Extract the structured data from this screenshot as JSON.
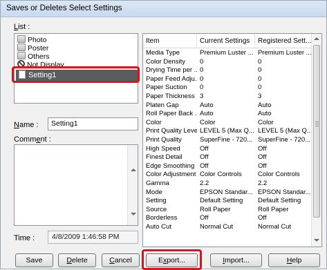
{
  "window": {
    "title": "Saves or Deletes Select Settings"
  },
  "list": {
    "label_prefix": "",
    "label_underline": "L",
    "label_rest": "ist :",
    "items": [
      {
        "label": "Photo",
        "icon": "folder-icon"
      },
      {
        "label": "Poster",
        "icon": "folder-icon"
      },
      {
        "label": "Others",
        "icon": "folder-icon"
      },
      {
        "label": "Not Display",
        "icon": "no-display-icon"
      }
    ],
    "selected": {
      "label": "Setting1",
      "icon": "document-icon"
    }
  },
  "name": {
    "label_underline": "N",
    "label_rest": "ame :",
    "value": "Setting1"
  },
  "comment": {
    "label_prefix": "Comm",
    "label_underline": "e",
    "label_rest": "nt :"
  },
  "time": {
    "label": "Time :",
    "value": "4/8/2009 1:46:58 PM"
  },
  "table": {
    "columns": [
      "Item",
      "Current Settings",
      "Registered Sett..."
    ],
    "rows": [
      [
        "Media Type",
        "Premium Luster ...",
        "Premium Luster ..."
      ],
      [
        "Color Density",
        "0",
        "0"
      ],
      [
        "Drying Time per ...",
        "0",
        "0"
      ],
      [
        "Paper Feed Adju...",
        "0",
        "0"
      ],
      [
        "Paper Suction",
        "0",
        "0"
      ],
      [
        "Paper Thickness",
        "3",
        "3"
      ],
      [
        "Platen Gap",
        "Auto",
        "Auto"
      ],
      [
        "Roll Paper Back ...",
        "Auto",
        "Auto"
      ],
      [
        "Color",
        "Color",
        "Color"
      ],
      [
        "Print Quality Level",
        "LEVEL 5 (Max Q...",
        "LEVEL 5 (Max Q..."
      ],
      [
        "Print Quality",
        "SuperFine - 720...",
        "SuperFine - 720..."
      ],
      [
        "High Speed",
        "Off",
        "Off"
      ],
      [
        "Finest Detail",
        "Off",
        "Off"
      ],
      [
        "Edge Smoothing",
        "Off",
        "Off"
      ],
      [
        "Color Adjustment",
        "Color Controls",
        "Color Controls"
      ],
      [
        "Gamma",
        "2.2",
        "2.2"
      ],
      [
        "Mode",
        "EPSON Standar...",
        "EPSON Standar..."
      ],
      [
        "Setting",
        "Default Setting",
        "Default Setting"
      ],
      [
        "Source",
        "Roll Paper",
        "Roll Paper"
      ],
      [
        "Borderless",
        "Off",
        "Off"
      ],
      [
        "Auto Cut",
        "Normal Cut",
        "Normal Cut"
      ]
    ]
  },
  "buttons": {
    "save": {
      "label": "Save"
    },
    "delete": {
      "underline": "D",
      "rest": "elete"
    },
    "cancel": {
      "underline": "C",
      "rest": "ancel"
    },
    "export": {
      "prefix": "E",
      "underline": "x",
      "rest": "port..."
    },
    "import": {
      "underline": "I",
      "rest": "mport..."
    },
    "help": {
      "underline": "H",
      "rest": "elp"
    }
  },
  "colors": {
    "highlight": "#d9141b",
    "selected_row": "#5c5c5c",
    "title_bar": "#c9daee"
  }
}
